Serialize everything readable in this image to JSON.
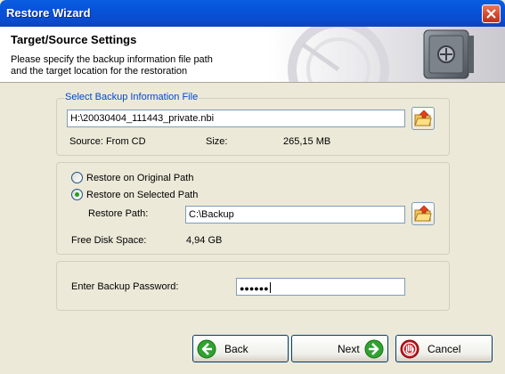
{
  "window": {
    "title": "Restore Wizard"
  },
  "header": {
    "title": "Target/Source Settings",
    "description_line1": "Please specify the backup information file path",
    "description_line2": "and the target location for the restoration"
  },
  "backup_file": {
    "legend": "Select Backup Information File",
    "path": "H:\\20030404_111443_private.nbi",
    "source_label": "Source: From CD",
    "size_label": "Size:",
    "size_value": "265,15 MB"
  },
  "restore_target": {
    "option_original": "Restore on Original Path",
    "option_selected": "Restore on Selected Path",
    "selected_option": "selected",
    "restore_path_label": "Restore Path:",
    "restore_path_value": "C:\\Backup",
    "free_space_label": "Free Disk Space:",
    "free_space_value": "4,94 GB"
  },
  "password": {
    "label": "Enter Backup Password:",
    "masked_value": "●●●●●●"
  },
  "buttons": {
    "back": "Back",
    "next": "Next",
    "cancel": "Cancel"
  },
  "colors": {
    "titlebar": "#0a5de0",
    "legend_text": "#0046d5",
    "dialog_bg": "#ece9d8",
    "arrow_green": "#2fa32f",
    "cancel_red": "#c0121a"
  },
  "icons": {
    "close": "close-icon",
    "browse": "folder-open-icon",
    "back": "arrow-left-icon",
    "next": "arrow-right-icon",
    "cancel": "stop-hand-icon",
    "header_art": "safe-vault-icon"
  }
}
